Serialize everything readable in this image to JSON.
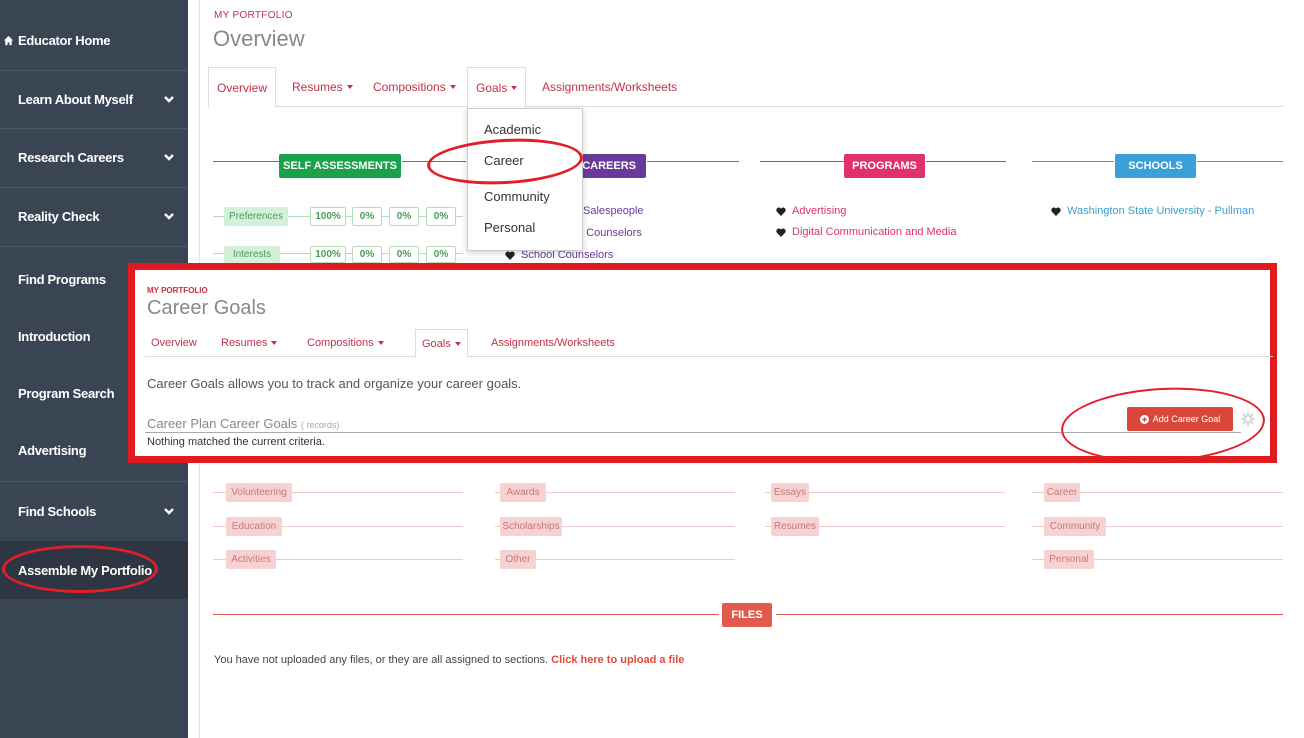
{
  "sidebar": {
    "items": [
      {
        "label": "Educator Home"
      },
      {
        "label": "Learn About Myself"
      },
      {
        "label": "Research Careers"
      },
      {
        "label": "Reality Check"
      },
      {
        "label": "Find Programs"
      },
      {
        "label": "Introduction"
      },
      {
        "label": "Program Search"
      },
      {
        "label": "Advertising"
      },
      {
        "label": "Find Schools"
      },
      {
        "label": "Assemble My Portfolio"
      }
    ]
  },
  "header": {
    "kicker": "MY PORTFOLIO",
    "title": "Overview"
  },
  "tabs": [
    {
      "label": "Overview"
    },
    {
      "label": "Resumes"
    },
    {
      "label": "Compositions"
    },
    {
      "label": "Goals"
    },
    {
      "label": "Assignments/Worksheets"
    }
  ],
  "goals_dropdown": [
    "Academic",
    "Career",
    "Community",
    "Personal"
  ],
  "sections": {
    "self_assessments": "SELF ASSESSMENTS",
    "careers": "CAREERS",
    "programs": "PROGRAMS",
    "schools": "SCHOOLS",
    "files": "FILES"
  },
  "self_assessments": [
    {
      "label": "Preferences",
      "scores": [
        "100%",
        "0%",
        "0%",
        "0%"
      ]
    },
    {
      "label": "Interests",
      "scores": [
        "100%",
        "0%",
        "0%",
        "0%"
      ]
    }
  ],
  "careers": [
    "Salespeople",
    "n Counselors",
    "School Counselors"
  ],
  "programs": [
    "Advertising",
    "Digital Communication and Media"
  ],
  "schools": [
    "Washington State University - Pullman"
  ],
  "activities_col": [
    "Volunteering",
    "Education",
    "Activities"
  ],
  "awards_col": [
    "Awards",
    "Scholarships",
    "Other"
  ],
  "compositions_col": [
    "Essays",
    "Resumes"
  ],
  "goals_col": [
    "Career",
    "Community",
    "Personal"
  ],
  "overlay": {
    "kicker": "MY PORTFOLIO",
    "title": "Career Goals",
    "tabs": [
      "Overview",
      "Resumes",
      "Compositions",
      "Goals",
      "Assignments/Worksheets"
    ],
    "description": "Career Goals allows you to track and organize your career goals.",
    "subheading": "Career Plan Career Goals",
    "subheading_note": "( records)",
    "empty_message": "Nothing matched the current criteria.",
    "add_button": "Add Career Goal"
  },
  "files": {
    "text": "You have not uploaded any files, or they are all assigned to sections.",
    "link": "Click here to upload a file"
  },
  "colors": {
    "sidebar": "#3a4553",
    "accent": "#c0324a",
    "self_assessments": "#1aa14a",
    "careers": "#6a3a9a",
    "programs": "#e0316a",
    "schools": "#3aa0d8",
    "files": "#e05a4e",
    "annotation": "#e01a1f"
  }
}
